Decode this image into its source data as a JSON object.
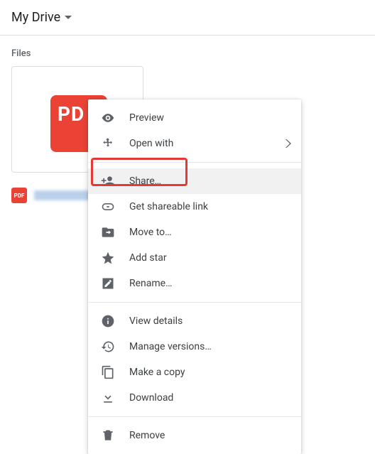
{
  "header": {
    "title": "My Drive"
  },
  "section": {
    "files_label": "Files"
  },
  "file": {
    "badge_text": "PD",
    "mini_badge_text": "PDF"
  },
  "menu": {
    "preview": "Preview",
    "open_with": "Open with",
    "share": "Share…",
    "get_link": "Get shareable link",
    "move_to": "Move to…",
    "add_star": "Add star",
    "rename": "Rename…",
    "view_details": "View details",
    "manage_versions": "Manage versions…",
    "make_copy": "Make a copy",
    "download": "Download",
    "remove": "Remove"
  }
}
